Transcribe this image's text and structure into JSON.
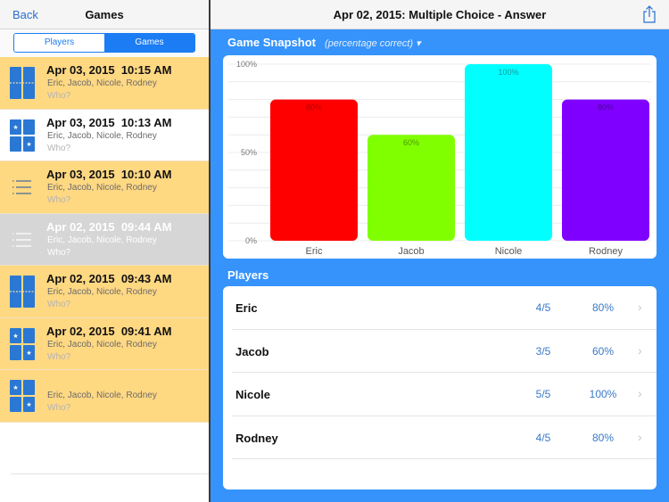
{
  "left_nav": {
    "back_label": "Back",
    "title": "Games"
  },
  "segmented": {
    "options": [
      "Players",
      "Games"
    ],
    "selected": "Games"
  },
  "games": [
    {
      "icon": "timeline-icon",
      "date": "Apr 03, 2015  10:15 AM",
      "players": "Eric, Jacob, Nicole, Rodney",
      "who": "Who?",
      "state": "highlight"
    },
    {
      "icon": "star-grid-icon",
      "date": "Apr 03, 2015  10:13 AM",
      "players": "Eric, Jacob, Nicole, Rodney",
      "who": "Who?",
      "state": "plain"
    },
    {
      "icon": "list-icon",
      "date": "Apr 03, 2015  10:10 AM",
      "players": "Eric, Jacob, Nicole, Rodney",
      "who": "Who?",
      "state": "highlight"
    },
    {
      "icon": "list-icon",
      "date": "Apr 02, 2015  09:44 AM",
      "players": "Eric, Jacob, Nicole, Rodney",
      "who": "Who?",
      "state": "selected"
    },
    {
      "icon": "timeline-icon",
      "date": "Apr 02, 2015  09:43 AM",
      "players": "Eric, Jacob, Nicole, Rodney",
      "who": "Who?",
      "state": "highlight"
    },
    {
      "icon": "star-grid-icon",
      "date": "Apr 02, 2015  09:41 AM",
      "players": "Eric, Jacob, Nicole, Rodney",
      "who": "Who?",
      "state": "highlight"
    },
    {
      "icon": "star-grid-icon",
      "date": "",
      "players": "Eric, Jacob, Nicole, Rodney",
      "who": "Who?",
      "state": "highlight"
    }
  ],
  "detail": {
    "title": "Apr 02, 2015: Multiple Choice - Answer",
    "share_icon": "share-icon",
    "snapshot_header": "Game Snapshot",
    "snapshot_mode": "(percentage correct) ▾",
    "players_header": "Players"
  },
  "colors": {
    "accent": "#1b7cf3",
    "detail_bg": "#3593fb",
    "highlight_row": "#ffd882",
    "selected_row": "#d6d6d6",
    "icon_blue": "#2a78d4"
  },
  "chart_data": {
    "type": "bar",
    "title": "Game Snapshot",
    "subtitle": "(percentage correct)",
    "categories": [
      "Eric",
      "Jacob",
      "Nicole",
      "Rodney"
    ],
    "values": [
      80,
      60,
      100,
      80
    ],
    "data_labels": [
      "80%",
      "60%",
      "100%",
      "80%"
    ],
    "bar_colors": [
      "#ff0000",
      "#80ff00",
      "#00ffff",
      "#8000ff"
    ],
    "label_colors": [
      "#b10000",
      "#4a9a00",
      "#1a9a9a",
      "#4a009a"
    ],
    "ylim": [
      0,
      100
    ],
    "yticks": [
      0,
      50,
      100
    ],
    "ytick_labels": [
      "0%",
      "50%",
      "100%"
    ],
    "grid": true,
    "grid_step": 10,
    "xlabel": "",
    "ylabel": ""
  },
  "players": [
    {
      "name": "Eric",
      "score": "4/5",
      "percent": "80%"
    },
    {
      "name": "Jacob",
      "score": "3/5",
      "percent": "60%"
    },
    {
      "name": "Nicole",
      "score": "5/5",
      "percent": "100%"
    },
    {
      "name": "Rodney",
      "score": "4/5",
      "percent": "80%"
    }
  ],
  "chevron": "›"
}
